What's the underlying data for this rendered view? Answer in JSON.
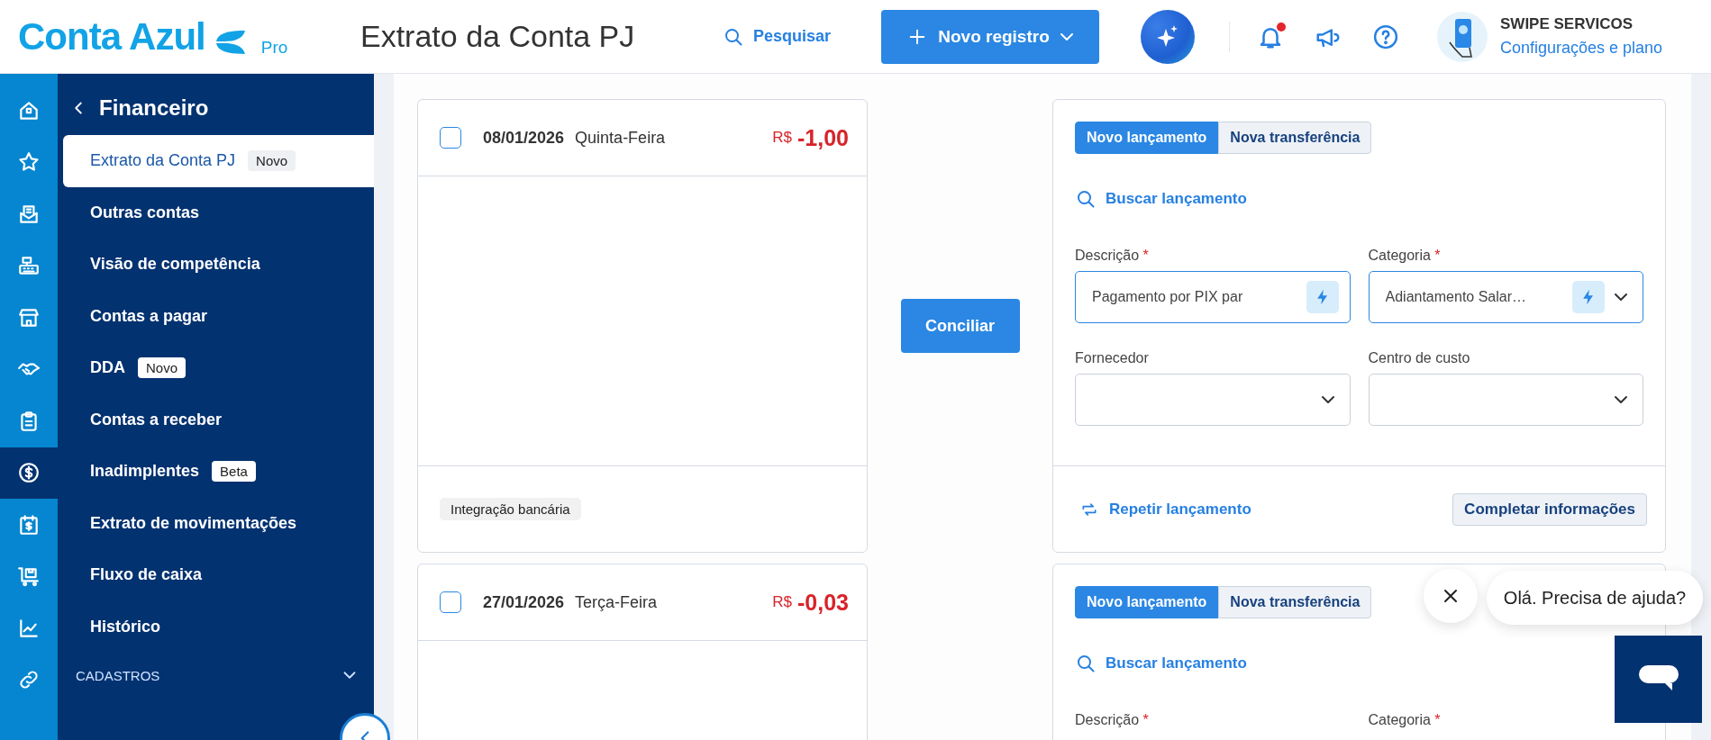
{
  "header": {
    "logo": "Conta Azul",
    "plan": "Pro",
    "title": "Extrato da Conta PJ",
    "search_link": "Pesquisar",
    "new_button": "Novo registro",
    "unread_notifications": true,
    "account_name": "SWIPE SERVICOS",
    "account_link": "Configurações e plano"
  },
  "rail": [
    {
      "selected": false
    },
    {
      "selected": false
    },
    {
      "selected": false
    },
    {
      "selected": false
    },
    {
      "selected": false
    },
    {
      "selected": false
    },
    {
      "selected": false
    },
    {
      "selected": true
    },
    {
      "selected": false
    },
    {
      "selected": false
    },
    {
      "selected": false
    },
    {
      "selected": false
    }
  ],
  "nav": {
    "title": "Financeiro",
    "items": [
      {
        "label": "Extrato da Conta PJ",
        "badge": "Novo",
        "selected": true
      },
      {
        "label": "Outras contas",
        "selected": false
      },
      {
        "label": "Visão de competência",
        "selected": false
      },
      {
        "label": "Contas a pagar",
        "selected": false
      },
      {
        "label": "DDA",
        "badge": "Novo",
        "selected": false
      },
      {
        "label": "Contas a receber",
        "selected": false
      },
      {
        "label": "Inadimplentes",
        "badge": "Beta",
        "selected": false
      },
      {
        "label": "Extrato de movimentações",
        "selected": false
      },
      {
        "label": "Fluxo de caixa",
        "selected": false
      },
      {
        "label": "Histórico",
        "selected": false
      }
    ],
    "sections": [
      {
        "label": "CADASTROS",
        "expanded": false
      }
    ]
  },
  "transactions": [
    {
      "checked": false,
      "date": "08/01/2026",
      "weekday": "Quinta-Feira",
      "currency": "R$",
      "amount": "-1,00",
      "tag": "Integração bancária",
      "reconcile_button": "Conciliar",
      "entry": {
        "tabs": [
          {
            "label": "Novo lançamento",
            "selected": true
          },
          {
            "label": "Nova transferência",
            "selected": false
          }
        ],
        "search_link": "Buscar lançamento",
        "fields": [
          {
            "kind": "text",
            "label": "Descrição",
            "required_mark": "*",
            "value": "Pagamento por PIX par",
            "suggested": true
          },
          {
            "kind": "select",
            "label": "Categoria",
            "required_mark": "*",
            "value": "Adiantamento Salar…",
            "suggested": true
          },
          {
            "kind": "select",
            "label": "Fornecedor"
          },
          {
            "kind": "select",
            "label": "Centro de custo"
          }
        ],
        "repeat_link": "Repetir lançamento",
        "complete_button": "Completar informações"
      }
    },
    {
      "checked": false,
      "date": "27/01/2026",
      "weekday": "Terça-Feira",
      "currency": "R$",
      "amount": "-0,03",
      "entry": {
        "tabs": [
          {
            "label": "Novo lançamento",
            "selected": true
          },
          {
            "label": "Nova transferência",
            "selected": false
          }
        ],
        "search_link": "Buscar lançamento",
        "fields": [
          {
            "kind": "label",
            "label": "Descrição",
            "required_mark": "*"
          },
          {
            "kind": "label",
            "label": "Categoria",
            "required_mark": "*"
          }
        ]
      }
    }
  ],
  "chat": {
    "greeting": "Olá. Precisa de ajuda?"
  }
}
